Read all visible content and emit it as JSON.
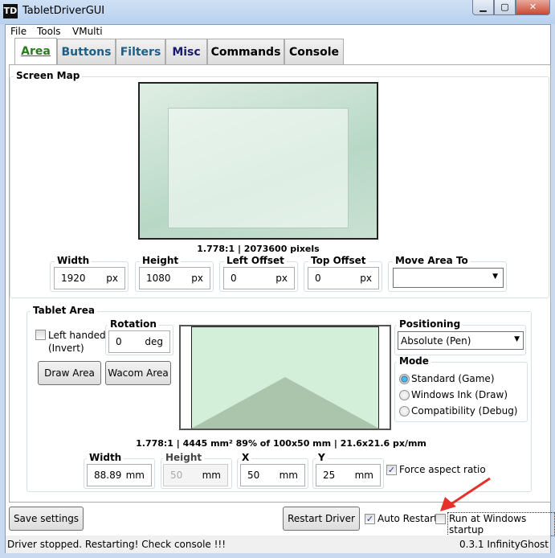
{
  "window": {
    "icon_text": "TD",
    "title": "TabletDriverGUI",
    "minimize": "▁",
    "maximize": "▢",
    "close": "✕"
  },
  "menu": [
    "File",
    "Tools",
    "VMulti"
  ],
  "tabs": [
    {
      "label": "Area",
      "active": true
    },
    {
      "label": "Buttons"
    },
    {
      "label": "Filters"
    },
    {
      "label": "Misc"
    },
    {
      "label": "Commands"
    },
    {
      "label": "Console"
    }
  ],
  "screen_map": {
    "title": "Screen Map",
    "info": "1.778:1 | 2073600 pixels",
    "fields": [
      {
        "label": "Width",
        "value": "1920",
        "unit": "px"
      },
      {
        "label": "Height",
        "value": "1080",
        "unit": "px"
      },
      {
        "label": "Left Offset",
        "value": "0",
        "unit": "px"
      },
      {
        "label": "Top Offset",
        "value": "0",
        "unit": "px"
      }
    ],
    "move_area": {
      "label": "Move Area To",
      "value": ""
    }
  },
  "tablet_area": {
    "title": "Tablet Area",
    "left_handed": "Left handed",
    "invert": "(Invert)",
    "left_handed_checked": false,
    "rotation": {
      "label": "Rotation",
      "value": "0",
      "unit": "deg"
    },
    "draw_area": "Draw Area",
    "wacom_area": "Wacom Area",
    "info": "1.778:1 | 4445 mm² 89% of 100x50 mm | 21.6x21.6 px/mm",
    "fields": [
      {
        "label": "Width",
        "value": "88.89",
        "unit": "mm"
      },
      {
        "label": "Height",
        "value": "50",
        "unit": "mm",
        "disabled": true
      },
      {
        "label": "X",
        "value": "50",
        "unit": "mm"
      },
      {
        "label": "Y",
        "value": "25",
        "unit": "mm"
      }
    ],
    "force_aspect": "Force aspect ratio",
    "force_aspect_checked": true,
    "positioning": {
      "label": "Positioning",
      "value": "Absolute (Pen)"
    },
    "mode": {
      "label": "Mode",
      "options": [
        "Standard (Game)",
        "Windows Ink (Draw)",
        "Compatibility (Debug)"
      ],
      "selected": 0
    }
  },
  "bottom": {
    "save": "Save settings",
    "restart": "Restart Driver",
    "auto_restart": "Auto Restart",
    "auto_restart_checked": true,
    "run_startup": "Run at Windows startup",
    "run_startup_checked": false
  },
  "status": {
    "message": "Driver stopped. Restarting! Check console !!!",
    "version": "0.3.1 InfinityGhost"
  },
  "colors": {
    "area_fill": "#d3efd9",
    "area_shape": "#abc5ad",
    "arrow": "#e8302a",
    "active_tab": "#2a7a1e"
  }
}
